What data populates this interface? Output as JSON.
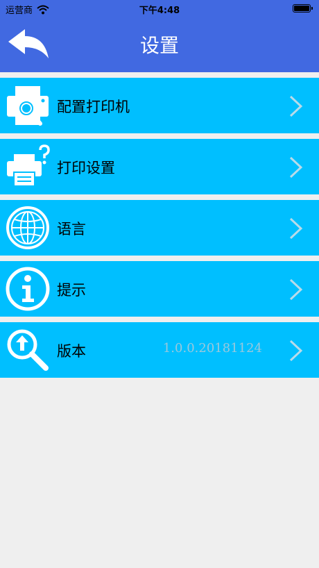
{
  "status_bar": {
    "carrier": "运营商",
    "time": "下午4:48",
    "icons": [
      "wifi-icon",
      "battery-icon"
    ]
  },
  "nav": {
    "title": "设置",
    "back_icon": "back-arrow-icon"
  },
  "colors": {
    "header": "#4169e1",
    "item_background": "#00bfff",
    "page_background": "#efefef",
    "version_text": "#9ac8dc"
  },
  "menu": {
    "items": [
      {
        "label": "配置打印机",
        "icon": "printer-search-icon",
        "value": ""
      },
      {
        "label": "打印设置",
        "icon": "printer-question-icon",
        "value": ""
      },
      {
        "label": "语言",
        "icon": "globe-icon",
        "value": ""
      },
      {
        "label": "提示",
        "icon": "info-icon",
        "value": ""
      },
      {
        "label": "版本",
        "icon": "update-search-icon",
        "value": "1.0.0.20181124"
      }
    ]
  }
}
